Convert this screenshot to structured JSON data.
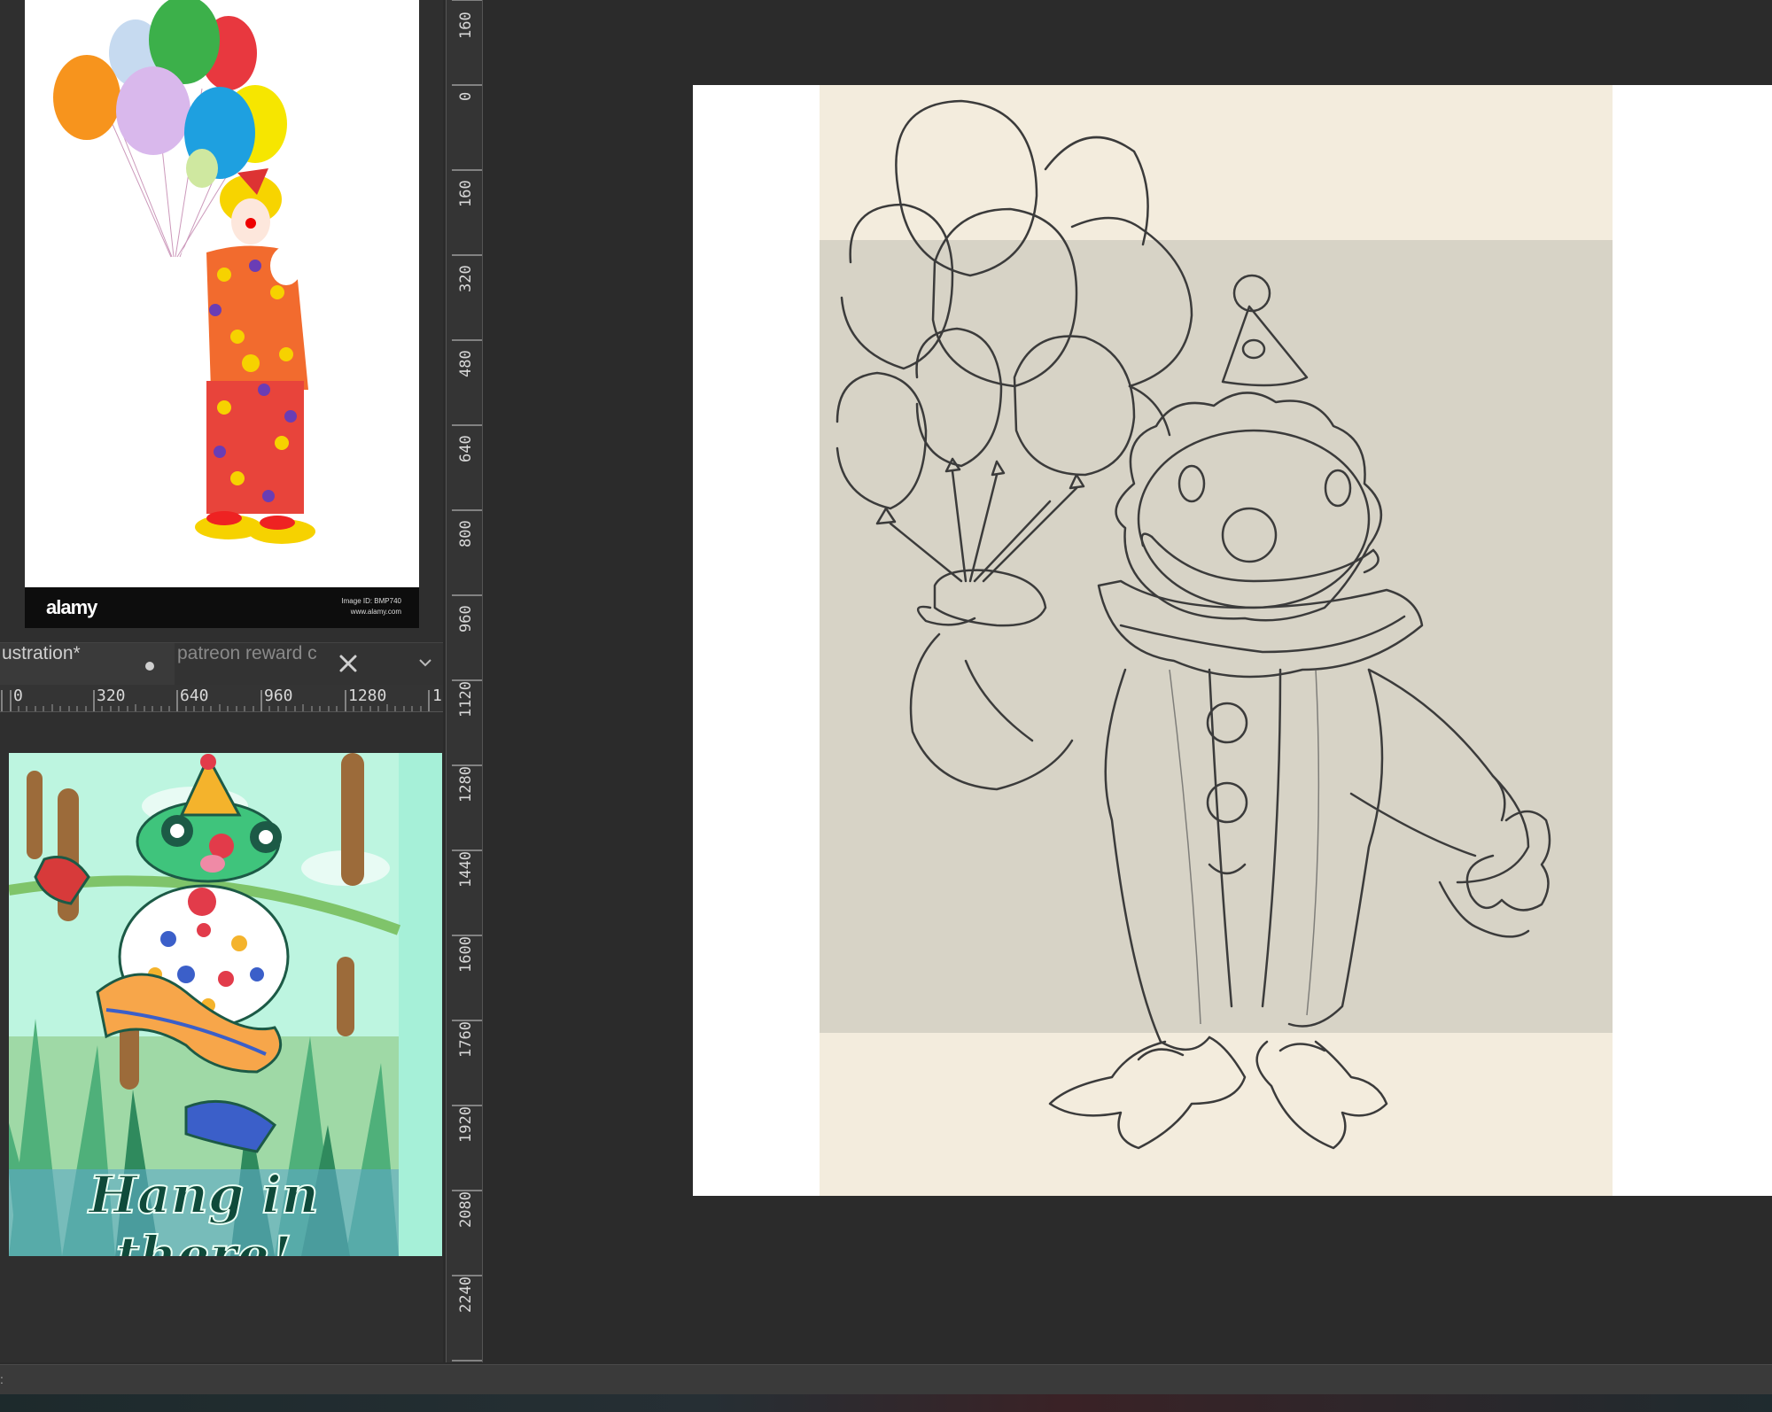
{
  "reference_photo": {
    "watermark_logo": "alamy",
    "image_id": "Image ID: BMP740",
    "site": "www.alamy.com"
  },
  "tabs": [
    {
      "label": "ustration*",
      "modified": true
    },
    {
      "label": "patreon reward c",
      "closable": true
    }
  ],
  "horizontal_ruler": {
    "labels": [
      "0",
      "320",
      "640",
      "960",
      "1280",
      "1"
    ]
  },
  "vertical_ruler": {
    "labels": [
      "160",
      "0",
      "160",
      "320",
      "480",
      "640",
      "800",
      "960",
      "1120",
      "1280",
      "1440",
      "1600",
      "1760",
      "1920",
      "2080",
      "2240"
    ]
  },
  "frog_artwork": {
    "caption": "Hang in there!"
  },
  "status": {
    "left_text": ":"
  },
  "icons": {
    "tab_close": "close-icon",
    "tab_menu": "chevron-down-icon",
    "modified": "dot-icon"
  },
  "colors": {
    "app_background": "#2b2b2b",
    "canvas_band_light": "#f3ecdd",
    "canvas_band_dark": "#d7d3c6",
    "sketch_stroke": "#3b3b3b"
  }
}
